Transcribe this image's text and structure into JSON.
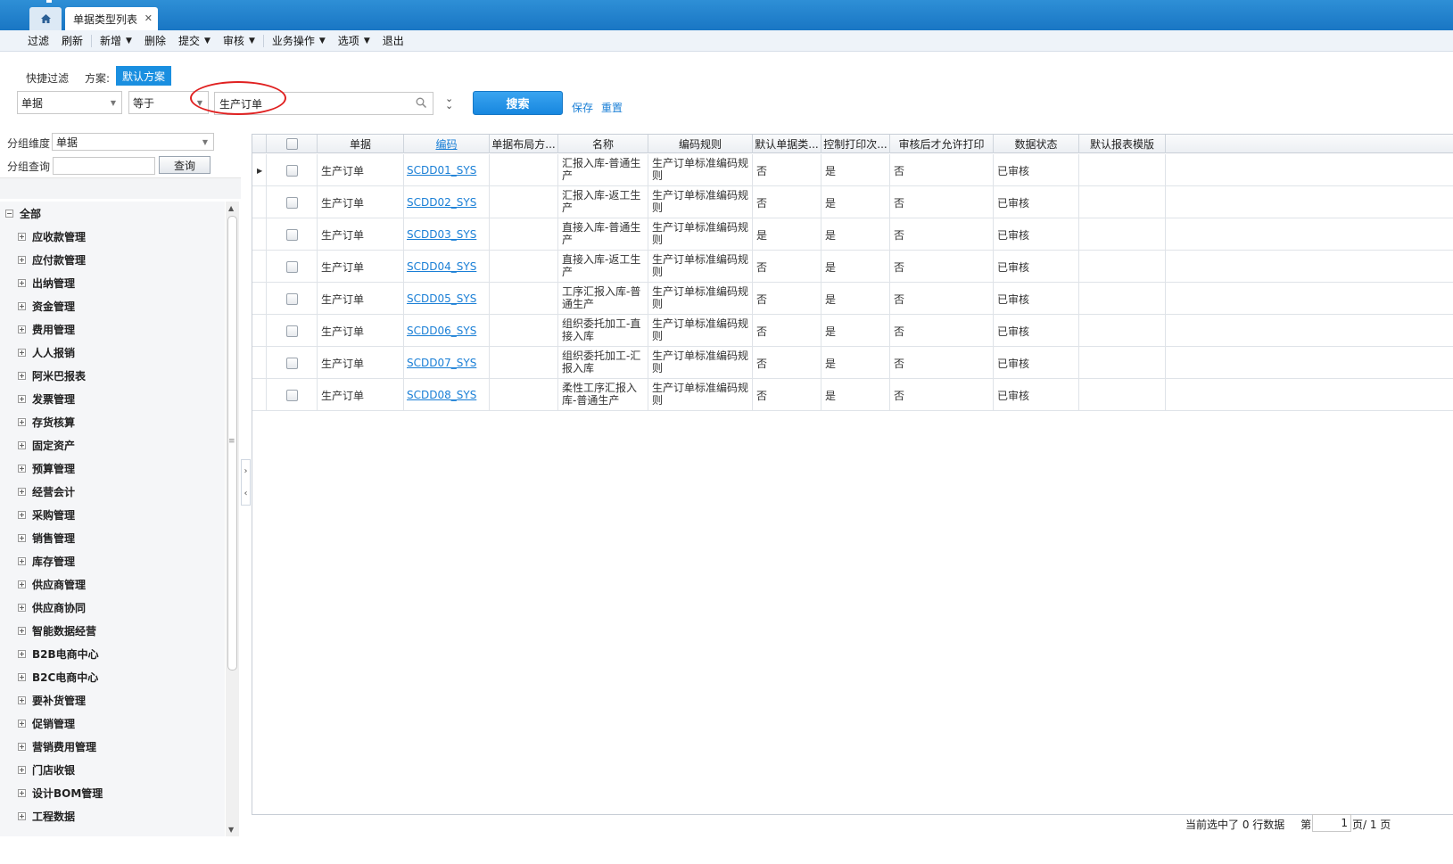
{
  "tabs": {
    "active_label": "单据类型列表"
  },
  "menu": [
    {
      "label": "过滤",
      "dropdown": false
    },
    {
      "label": "刷新",
      "dropdown": false
    },
    {
      "label": "新增",
      "dropdown": true
    },
    {
      "label": "删除",
      "dropdown": false
    },
    {
      "label": "提交",
      "dropdown": true
    },
    {
      "label": "审核",
      "dropdown": true
    },
    {
      "label": "业务操作",
      "dropdown": true
    },
    {
      "label": "选项",
      "dropdown": true
    },
    {
      "label": "退出",
      "dropdown": false
    }
  ],
  "filter": {
    "quick_label": "快捷过滤",
    "scheme_label": "方案:",
    "scheme_value": "默认方案",
    "field_value": "单据",
    "operator_value": "等于",
    "condition_value": "生产订单",
    "search_label": "搜索",
    "save_label": "保存",
    "reset_label": "重置"
  },
  "left": {
    "group_dim_label": "分组维度",
    "group_dim_value": "单据",
    "group_query_label": "分组查询",
    "group_query_value": "",
    "query_button": "查询",
    "tree_root": "全部",
    "tree_items": [
      "应收款管理",
      "应付款管理",
      "出纳管理",
      "资金管理",
      "费用管理",
      "人人报销",
      "阿米巴报表",
      "发票管理",
      "存货核算",
      "固定资产",
      "预算管理",
      "经营会计",
      "采购管理",
      "销售管理",
      "库存管理",
      "供应商管理",
      "供应商协同",
      "智能数据经营",
      "B2B电商中心",
      "B2C电商中心",
      "要补货管理",
      "促销管理",
      "营销费用管理",
      "门店收银",
      "设计BOM管理",
      "工程数据"
    ]
  },
  "grid": {
    "columns": [
      "单据",
      "编码",
      "单据布局方...",
      "名称",
      "编码规则",
      "默认单据类...",
      "控制打印次...",
      "审核后才允许打印",
      "数据状态",
      "默认报表模版"
    ],
    "rows": [
      {
        "bill": "生产订单",
        "code": "SCDD01_SYS",
        "layout": "",
        "name": "汇报入库-普通生产",
        "rule": "生产订单标准编码规则",
        "default": "否",
        "print_ctrl": "是",
        "print_after": "否",
        "status": "已审核",
        "report": ""
      },
      {
        "bill": "生产订单",
        "code": "SCDD02_SYS",
        "layout": "",
        "name": "汇报入库-返工生产",
        "rule": "生产订单标准编码规则",
        "default": "否",
        "print_ctrl": "是",
        "print_after": "否",
        "status": "已审核",
        "report": ""
      },
      {
        "bill": "生产订单",
        "code": "SCDD03_SYS",
        "layout": "",
        "name": "直接入库-普通生产",
        "rule": "生产订单标准编码规则",
        "default": "是",
        "print_ctrl": "是",
        "print_after": "否",
        "status": "已审核",
        "report": ""
      },
      {
        "bill": "生产订单",
        "code": "SCDD04_SYS",
        "layout": "",
        "name": "直接入库-返工生产",
        "rule": "生产订单标准编码规则",
        "default": "否",
        "print_ctrl": "是",
        "print_after": "否",
        "status": "已审核",
        "report": ""
      },
      {
        "bill": "生产订单",
        "code": "SCDD05_SYS",
        "layout": "",
        "name": "工序汇报入库-普通生产",
        "rule": "生产订单标准编码规则",
        "default": "否",
        "print_ctrl": "是",
        "print_after": "否",
        "status": "已审核",
        "report": ""
      },
      {
        "bill": "生产订单",
        "code": "SCDD06_SYS",
        "layout": "",
        "name": "组织委托加工-直接入库",
        "rule": "生产订单标准编码规则",
        "default": "否",
        "print_ctrl": "是",
        "print_after": "否",
        "status": "已审核",
        "report": ""
      },
      {
        "bill": "生产订单",
        "code": "SCDD07_SYS",
        "layout": "",
        "name": "组织委托加工-汇报入库",
        "rule": "生产订单标准编码规则",
        "default": "否",
        "print_ctrl": "是",
        "print_after": "否",
        "status": "已审核",
        "report": ""
      },
      {
        "bill": "生产订单",
        "code": "SCDD08_SYS",
        "layout": "",
        "name": "柔性工序汇报入库-普通生产",
        "rule": "生产订单标准编码规则",
        "default": "否",
        "print_ctrl": "是",
        "print_after": "否",
        "status": "已审核",
        "report": ""
      }
    ]
  },
  "status": {
    "selected_text": "当前选中了 0 行数据",
    "page_prefix": "第",
    "page_current": "1",
    "page_suffix": "页/ 1 页"
  },
  "colors": {
    "accent": "#1a8fe0",
    "topbar": "#1976c4",
    "link": "#1a7fd6",
    "annotation_circle": "#e02020"
  }
}
